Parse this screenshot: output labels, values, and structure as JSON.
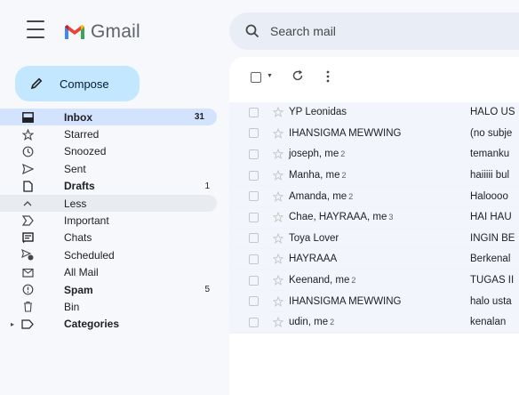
{
  "app": {
    "name": "Gmail"
  },
  "search": {
    "placeholder": "Search mail"
  },
  "compose": {
    "label": "Compose"
  },
  "sidebar": {
    "items": [
      {
        "label": "Inbox",
        "count": "31",
        "icon": "inbox-icon",
        "bold": true,
        "active": true
      },
      {
        "label": "Starred",
        "count": "",
        "icon": "star-icon"
      },
      {
        "label": "Snoozed",
        "count": "",
        "icon": "clock-icon"
      },
      {
        "label": "Sent",
        "count": "",
        "icon": "send-icon"
      },
      {
        "label": "Drafts",
        "count": "1",
        "icon": "draft-icon",
        "bold": true
      },
      {
        "label": "Less",
        "count": "",
        "icon": "chevron-up-icon",
        "hover": true
      },
      {
        "label": "Important",
        "count": "",
        "icon": "important-icon"
      },
      {
        "label": "Chats",
        "count": "",
        "icon": "chat-icon"
      },
      {
        "label": "Scheduled",
        "count": "",
        "icon": "scheduled-icon"
      },
      {
        "label": "All Mail",
        "count": "",
        "icon": "all-mail-icon"
      },
      {
        "label": "Spam",
        "count": "5",
        "icon": "spam-icon",
        "bold": true
      },
      {
        "label": "Bin",
        "count": "",
        "icon": "trash-icon"
      },
      {
        "label": "Categories",
        "count": "",
        "icon": "label-icon",
        "bold": true
      }
    ]
  },
  "emails": [
    {
      "from": "YP Leonidas",
      "n": "",
      "subject": "HALO US"
    },
    {
      "from": "IHANSIGMA MEWWING",
      "n": "",
      "subject": "(no subje"
    },
    {
      "from": "joseph, me",
      "n": "2",
      "subject": "temanku"
    },
    {
      "from": "Manha, me",
      "n": "2",
      "subject": "haiiiii bul"
    },
    {
      "from": "Amanda, me",
      "n": "2",
      "subject": "Haloooo"
    },
    {
      "from": "Chae, HAYRAAA, me",
      "n": "3",
      "subject": "HAI HAU"
    },
    {
      "from": "Toya Lover",
      "n": "",
      "subject": "INGIN BE"
    },
    {
      "from": "HAYRAAA",
      "n": "",
      "subject": "Berkenal"
    },
    {
      "from": "Keenand, me",
      "n": "2",
      "subject": "TUGAS II"
    },
    {
      "from": "IHANSIGMA MEWWING",
      "n": "",
      "subject": "halo usta"
    },
    {
      "from": "udin, me",
      "n": "2",
      "subject": "kenalan"
    }
  ],
  "colors": {
    "compose_bg": "#c2e7ff",
    "active_bg": "#d3e3fd",
    "search_bg": "#e9eef6",
    "page_bg": "#f6f8fc"
  }
}
